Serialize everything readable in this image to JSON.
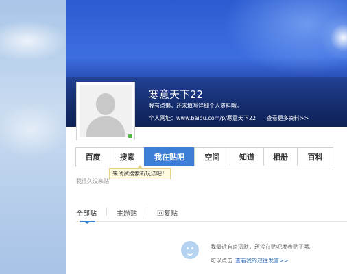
{
  "profile": {
    "username": "寒意天下22",
    "description": "我有点懒，还未填写详细个人资料哦。",
    "url_label": "个人网址：www.baidu.com/p/寒意天下22",
    "more_link": "查看更多资料>>"
  },
  "nav": {
    "tabs": [
      {
        "label": "百度"
      },
      {
        "label": "搜索"
      },
      {
        "label": "我在贴吧",
        "active": true
      },
      {
        "label": "空间"
      },
      {
        "label": "知道"
      },
      {
        "label": "相册"
      },
      {
        "label": "百科"
      }
    ]
  },
  "notice": "我很久没来贴",
  "tooltip": "来试试搜索新玩法吧！",
  "subtabs": [
    {
      "label": "全部贴",
      "active": true
    },
    {
      "label": "主题贴"
    },
    {
      "label": "回复贴"
    }
  ],
  "empty_state": {
    "line1": "我最近有点沉默，还没在贴吧发表贴子哦。",
    "line2_prefix": "可以点击",
    "line2_link": "查看我的过往发言>>"
  },
  "colors": {
    "accent": "#3d7fd6",
    "banner": "#2c5bd1",
    "online": "#4fbf3f"
  },
  "icons": {
    "avatar": "default-avatar-icon",
    "empty": "smiley-icon"
  }
}
